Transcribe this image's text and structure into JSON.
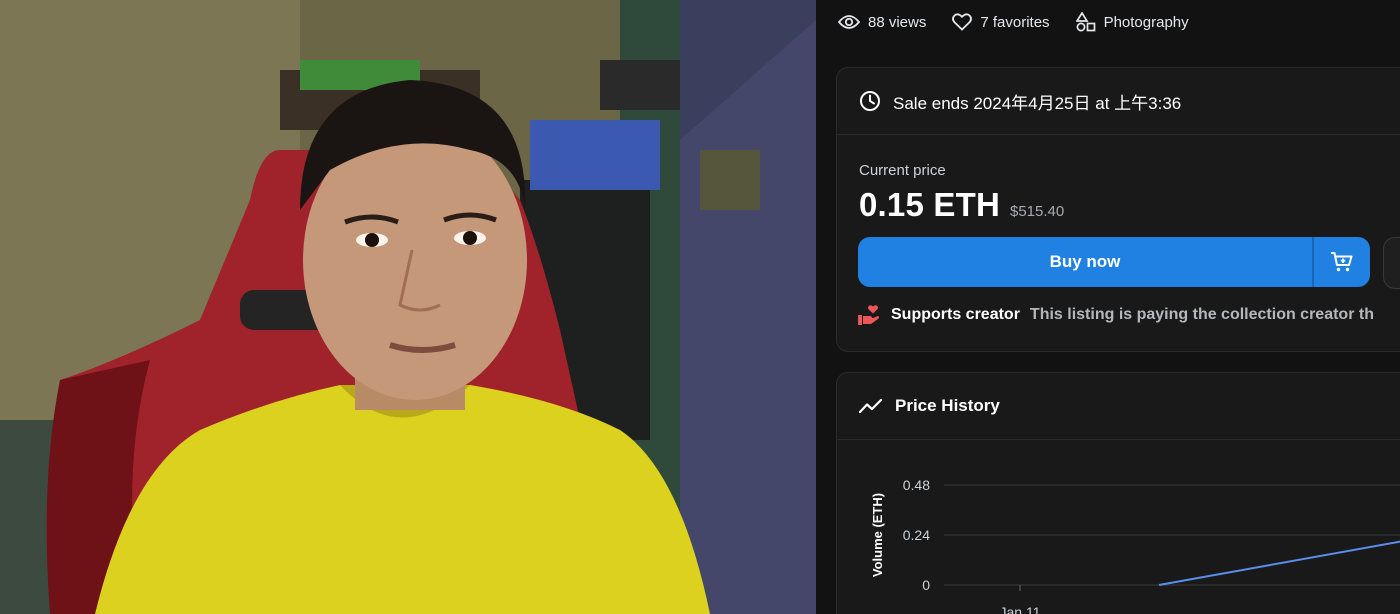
{
  "stats": {
    "views": "88 views",
    "favorites": "7 favorites",
    "category": "Photography"
  },
  "sale": {
    "ends_text": "Sale ends 2024年4月25日 at 上午3:36",
    "price_label": "Current price",
    "price": "0.15 ETH",
    "price_usd": "$515.40",
    "buy_label": "Buy now",
    "creator_title": "Supports creator",
    "creator_text": "This listing is paying the collection creator th"
  },
  "history": {
    "title": "Price History"
  },
  "chart_data": {
    "type": "line",
    "ylabel": "Volume (ETH)",
    "yticks": [
      "0.48",
      "0.24",
      "0"
    ],
    "ylim": [
      0,
      0.48
    ],
    "xticks": [
      "Jan 11"
    ],
    "series": [
      {
        "values": [
          {
            "x": 0.0,
            "y": 0
          },
          {
            "x": 1.0,
            "y": 0.24
          }
        ]
      }
    ]
  },
  "colors": {
    "accent": "#2081e2",
    "line": "#5b8def",
    "background": "#121212",
    "card": "#191919"
  }
}
